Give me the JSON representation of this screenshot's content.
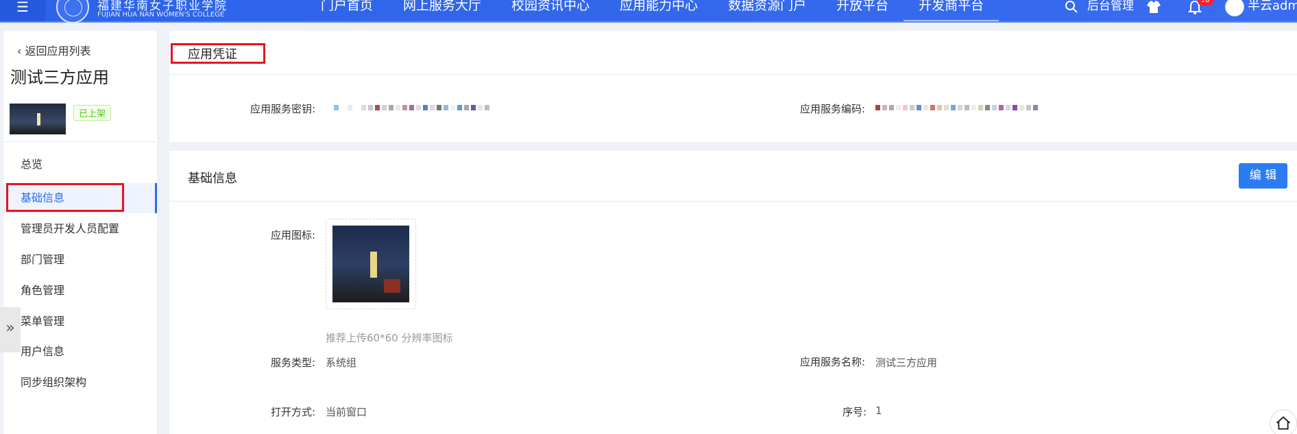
{
  "topbar": {
    "menu_icon": "menu-icon",
    "logo_cn": "福建华南女子职业学院",
    "logo_en": "FUJIAN HUA NAN WOMEN'S COLLEGE",
    "nav": [
      "门户首页",
      "网上服务大厅",
      "校园资讯中心",
      "应用能力中心",
      "数据资源门户",
      "开放平台",
      "开发商平台"
    ],
    "active_nav": "开发商平台",
    "admin_label": "后台管理",
    "notification_count": "10",
    "username": "半云admi"
  },
  "sidebar": {
    "back_label": "返回应用列表",
    "app_name": "测试三方应用",
    "status": "已上架",
    "items": [
      "总览",
      "基础信息",
      "管理员开发人员配置",
      "部门管理",
      "角色管理",
      "菜单管理",
      "用户信息",
      "同步组织架构"
    ],
    "active_item": "基础信息"
  },
  "credentials": {
    "title": "应用凭证",
    "secret_label": "应用服务密钥:",
    "code_label": "应用服务编码:"
  },
  "basic_info": {
    "title": "基础信息",
    "edit_label": "编 辑",
    "icon_label": "应用图标:",
    "icon_hint": "推荐上传60*60 分辨率图标",
    "service_type_label": "服务类型:",
    "service_type_value": "系统组",
    "service_name_label": "应用服务名称:",
    "service_name_value": "测试三方应用",
    "open_mode_label": "打开方式:",
    "open_mode_value": "当前窗口",
    "order_label": "序号:",
    "order_value": "1"
  },
  "colors": {
    "primary": "#2b6cf0",
    "highlight_box": "#e8131c",
    "status_green": "#52c41a"
  }
}
